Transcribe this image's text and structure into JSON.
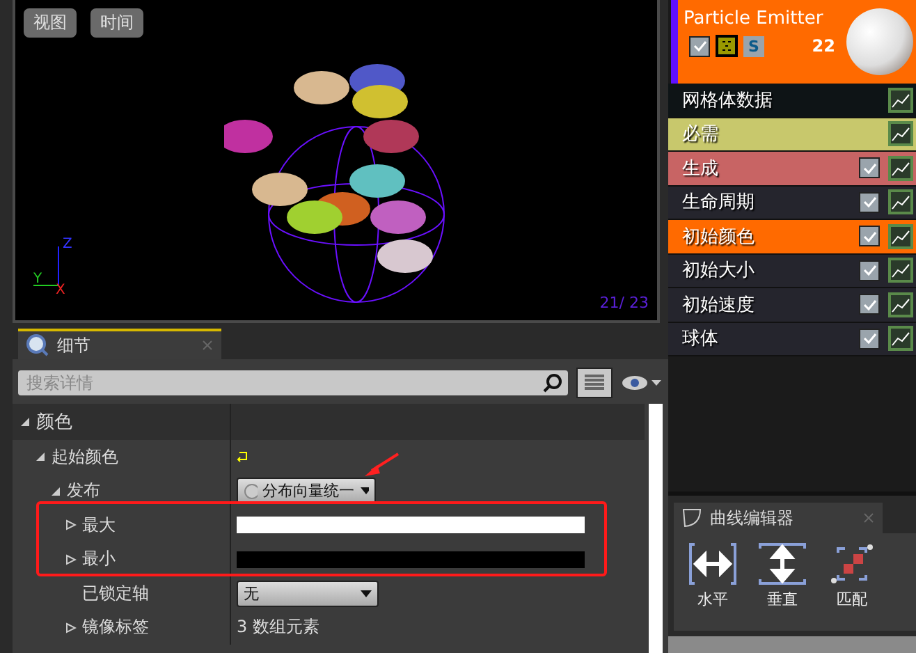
{
  "viewport": {
    "buttons": [
      "视图",
      "时间"
    ],
    "axes": [
      "Z",
      "Y",
      "X"
    ],
    "counter": "21/ 23"
  },
  "details": {
    "tab": {
      "label": "细节",
      "selected": true
    },
    "search": {
      "placeholder": "搜索详情"
    },
    "rows": [
      {
        "kind": "category",
        "label": "颜色",
        "expanded": true,
        "children": [
          {
            "kind": "reset",
            "label": "起始颜色",
            "expanded": true,
            "children": [
              {
                "kind": "dropdown",
                "label": "发布",
                "expanded": true,
                "value": "分布向量统一",
                "children": [
                  {
                    "kind": "color",
                    "label": "最大",
                    "expanded": false,
                    "color": "#ffffff"
                  },
                  {
                    "kind": "color",
                    "label": "最小",
                    "expanded": false,
                    "color": "#000000"
                  },
                  {
                    "kind": "dropdown",
                    "label": "已锁定轴",
                    "value": "无"
                  },
                  {
                    "kind": "text",
                    "label": "镜像标签",
                    "expanded": false,
                    "value": "3 数组元素"
                  }
                ]
              }
            ]
          }
        ]
      }
    ]
  },
  "emitter": {
    "title": "Particle Emitter",
    "enabled": true,
    "s_label": "S",
    "count": "22"
  },
  "modules": [
    {
      "label": "网格体数据",
      "kind": "fixed",
      "color": "#0e1416"
    },
    {
      "label": "必需",
      "kind": "fixed",
      "color": "#c8c86c"
    },
    {
      "label": "生成",
      "kind": "module",
      "checked": true,
      "color": "#c86464"
    },
    {
      "label": "生命周期",
      "kind": "module",
      "checked": true,
      "color": "#25252d"
    },
    {
      "label": "初始颜色",
      "kind": "module",
      "checked": true,
      "color": "#ff6a00"
    },
    {
      "label": "初始大小",
      "kind": "module",
      "checked": true,
      "color": "#25252d"
    },
    {
      "label": "初始速度",
      "kind": "module",
      "checked": true,
      "color": "#25252d"
    },
    {
      "label": "球体",
      "kind": "module",
      "checked": true,
      "color": "#25252d"
    }
  ],
  "curve_editor": {
    "tab": "曲线编辑器",
    "tools": [
      "水平",
      "垂直",
      "匹配"
    ]
  }
}
